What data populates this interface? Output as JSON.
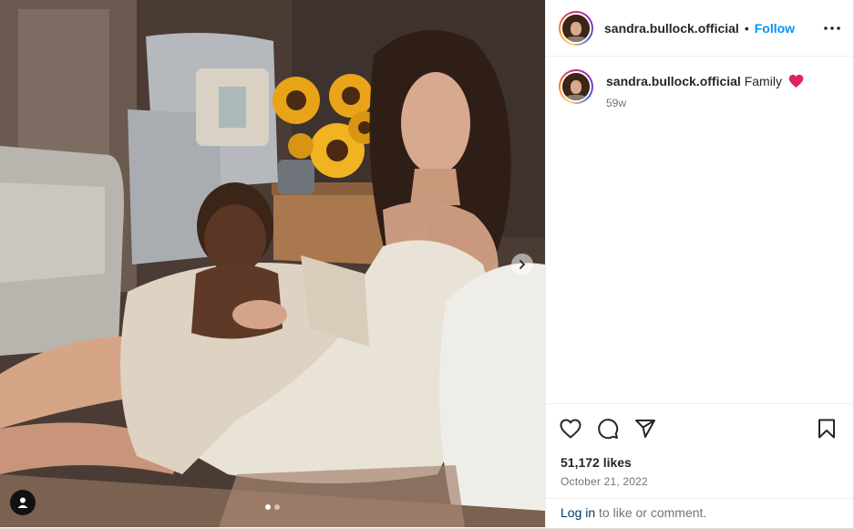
{
  "post": {
    "username": "sandra.bullock.official",
    "follow_label": "Follow",
    "separator": "•",
    "caption": {
      "username": "sandra.bullock.official",
      "text": "Family",
      "emoji": "red-heart"
    },
    "time_ago": "59w",
    "likes": "51,172 likes",
    "date": "October 21, 2022",
    "login_link": "Log in",
    "login_suffix": " to like or comment."
  },
  "icons": {
    "more": "more-horizontal-icon",
    "like": "heart-icon",
    "comment": "comment-icon",
    "share": "send-icon",
    "save": "bookmark-icon",
    "carousel_next": "chevron-right-icon",
    "tags": "user-tag-icon"
  },
  "carousel": {
    "slides": 2,
    "current": 1
  },
  "colors": {
    "accent": "#0095f6",
    "link": "#00376b",
    "muted": "#737373",
    "text": "#262626",
    "heart": "#ed4956"
  }
}
